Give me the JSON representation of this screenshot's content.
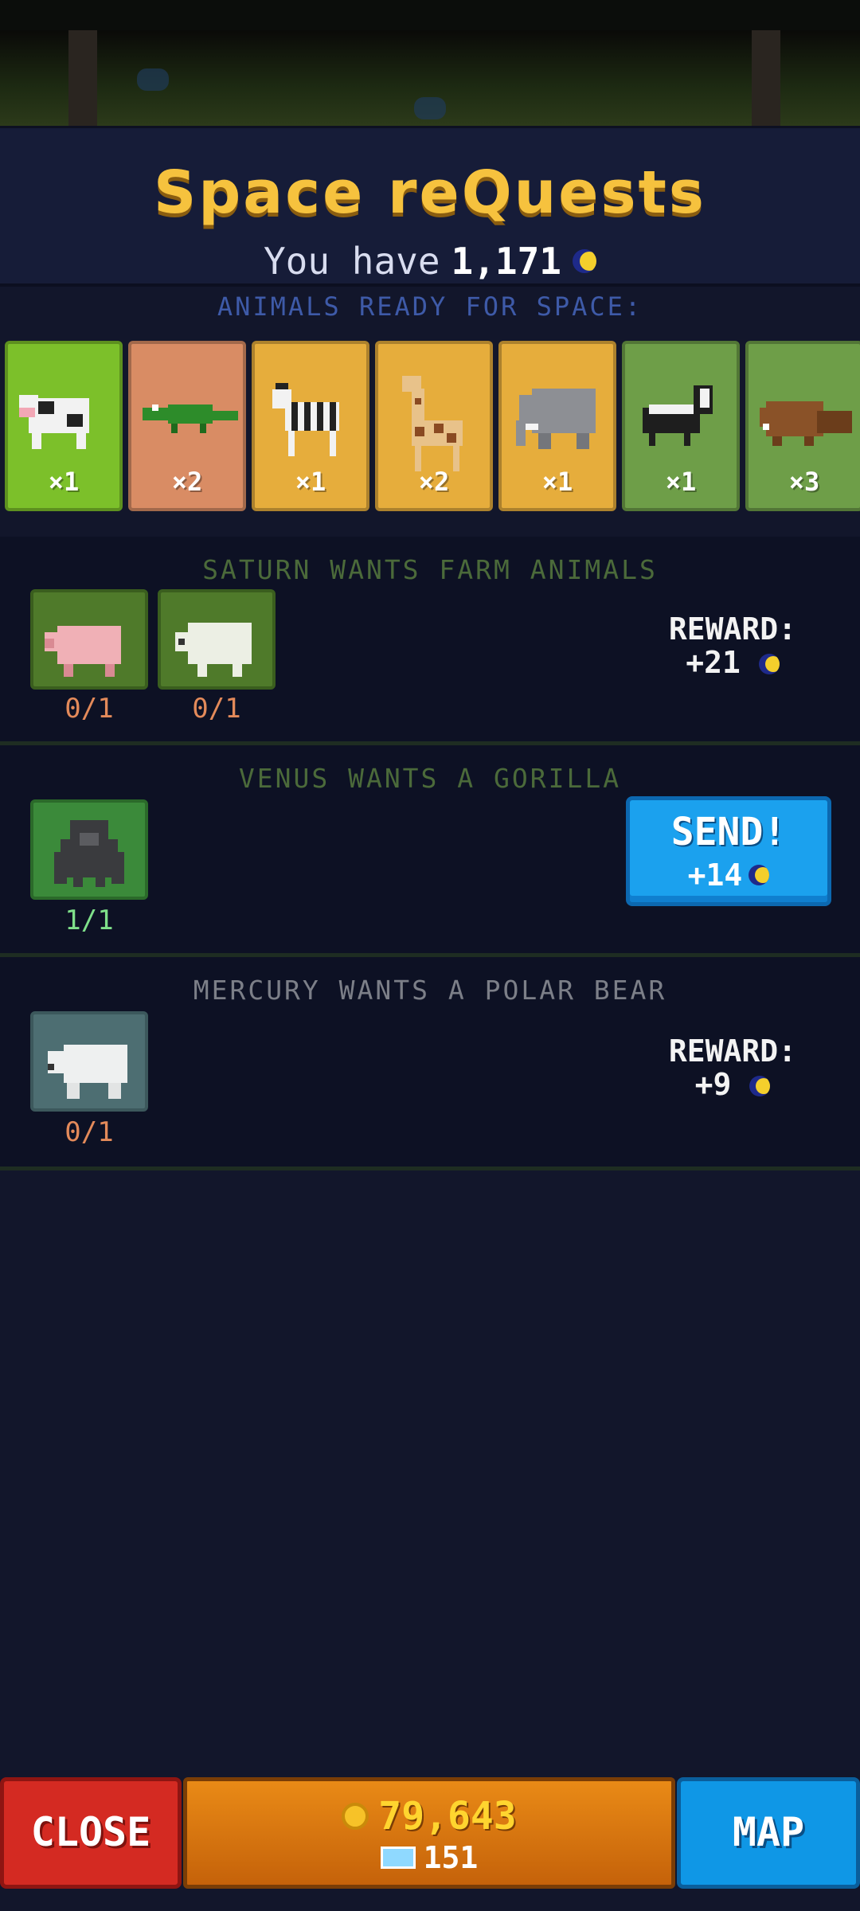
{
  "header": {
    "title": "Space reQuests",
    "balance_prefix": "You have",
    "balance_value": "1,171",
    "balance_icon": "moon-currency-icon"
  },
  "ready": {
    "label": "ANIMALS READY FOR SPACE:",
    "animals": [
      {
        "name": "cow-icon",
        "count": "×1",
        "color": "#7cc02a"
      },
      {
        "name": "crocodile-icon",
        "count": "×2",
        "color": "#d98c64"
      },
      {
        "name": "zebra-icon",
        "count": "×1",
        "color": "#e6ad3c"
      },
      {
        "name": "giraffe-icon",
        "count": "×2",
        "color": "#e6ad3c"
      },
      {
        "name": "elephant-icon",
        "count": "×1",
        "color": "#e6ad3c"
      },
      {
        "name": "skunk-icon",
        "count": "×1",
        "color": "#6e9e48"
      },
      {
        "name": "beaver-icon",
        "count": "×3",
        "color": "#6e9e48"
      }
    ]
  },
  "requests": [
    {
      "title": "SATURN WANTS FARM ANIMALS",
      "title_color": "#4b6a3a",
      "items": [
        {
          "name": "pig-icon",
          "progress": "0/1",
          "progress_color": "#e38a5a"
        },
        {
          "name": "sheep-icon",
          "progress": "0/1",
          "progress_color": "#e38a5a"
        }
      ],
      "reward_label": "REWARD:",
      "reward_value": "+21"
    },
    {
      "title": "VENUS WANTS A GORILLA",
      "title_color": "#4b6a3a",
      "items": [
        {
          "name": "gorilla-icon",
          "progress": "1/1",
          "progress_color": "#7fe08a"
        }
      ],
      "send_label": "SEND!",
      "send_reward": "+14"
    },
    {
      "title": "MERCURY WANTS A POLAR BEAR",
      "title_color": "#7c7f88",
      "items": [
        {
          "name": "polar-bear-icon",
          "progress": "0/1",
          "progress_color": "#e38a5a"
        }
      ],
      "reward_label": "REWARD:",
      "reward_value": "+9"
    }
  ],
  "footer": {
    "close_label": "CLOSE",
    "coins": "79,643",
    "gems": "151",
    "map_label": "MAP"
  }
}
